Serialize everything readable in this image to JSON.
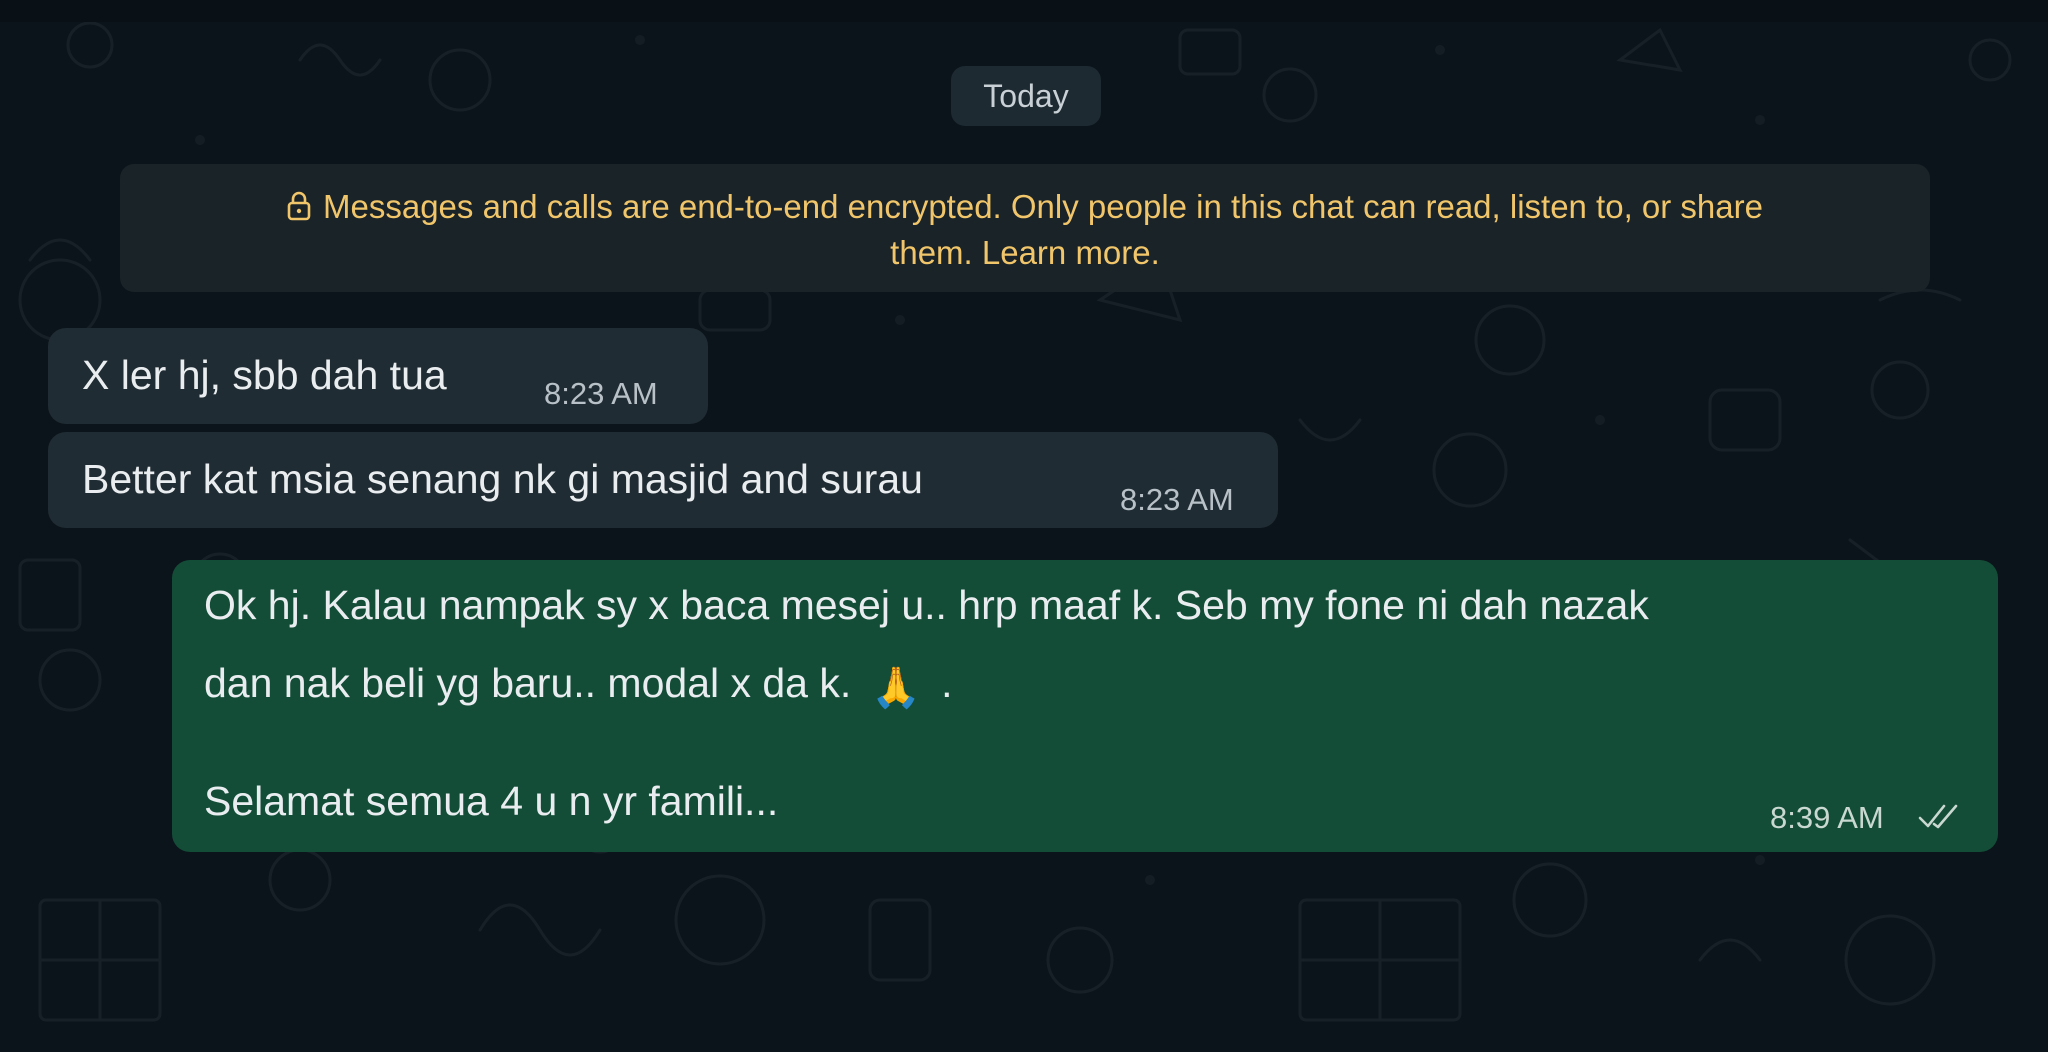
{
  "chat": {
    "date_separator": "Today",
    "encryption_notice": {
      "line1": "Messages and calls are end-to-end encrypted. Only people in this chat can read, listen to, or share",
      "line2_prefix": "them. ",
      "learn_more": "Learn more."
    },
    "messages": [
      {
        "direction": "incoming",
        "text": "X ler hj, sbb dah tua",
        "time": "8:23 AM"
      },
      {
        "direction": "incoming",
        "text": "Better kat msia senang nk gi masjid and surau",
        "time": "8:23 AM"
      },
      {
        "direction": "outgoing",
        "line1": "Ok hj. Kalau nampak sy x baca mesej u.. hrp maaf k. Seb my fone ni dah nazak",
        "line2_prefix": "dan nak beli yg baru.. modal x da k.",
        "emoji": "🙏",
        "line2_suffix": ".",
        "line3": "Selamat semua 4 u n yr famili...",
        "time": "8:39 AM",
        "status_icon": "double-check-read"
      }
    ]
  },
  "colors": {
    "background": "#0b141a",
    "incoming_bubble": "#202c33",
    "outgoing_bubble": "#134d37",
    "notice_text": "#f1c66b",
    "notice_bg": "#1a2328"
  }
}
